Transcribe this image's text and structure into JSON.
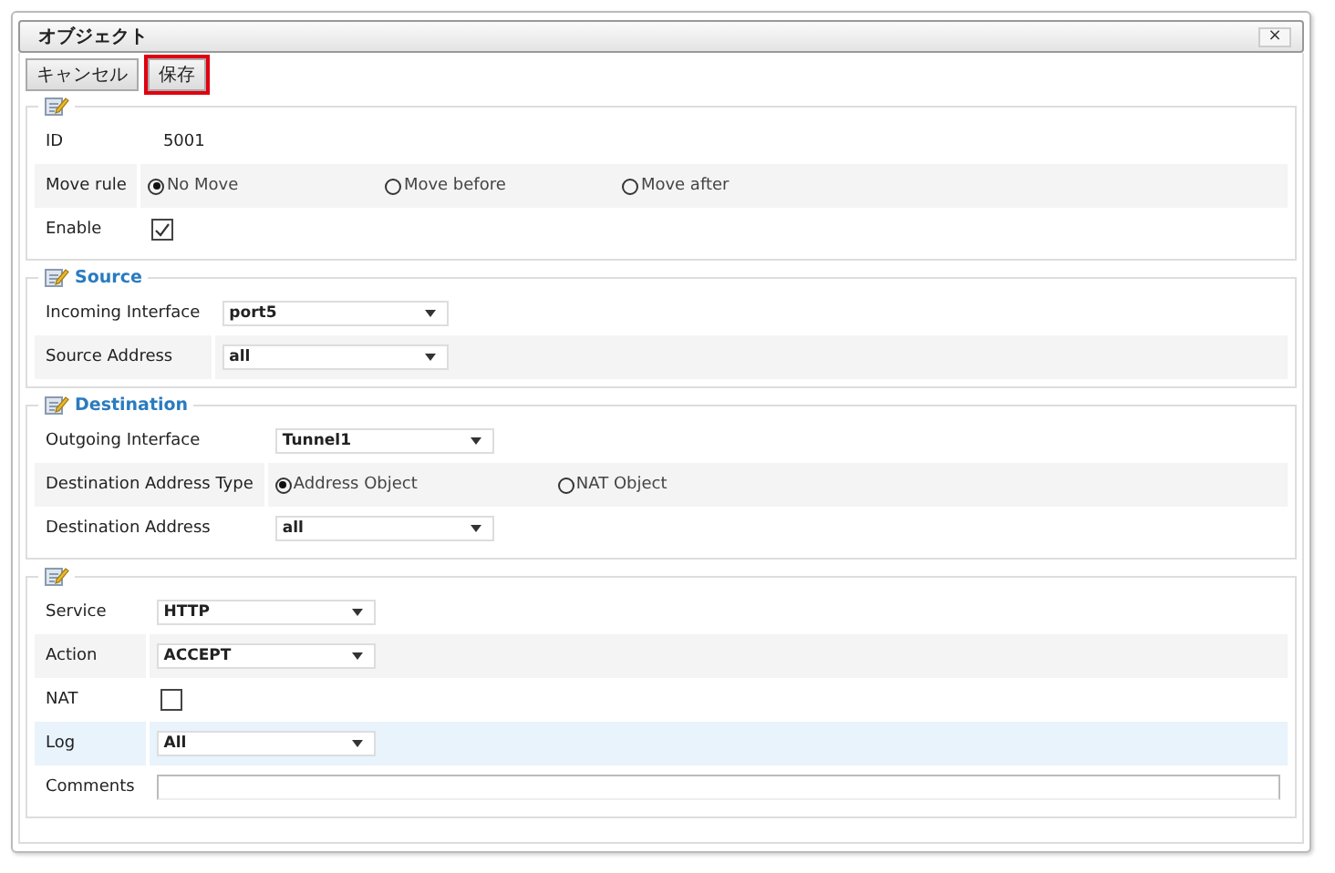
{
  "window": {
    "title": "オブジェクト",
    "close": "×"
  },
  "toolbar": [
    {
      "label": "キャンセル",
      "focused": false
    },
    {
      "label": "保存",
      "focused": true
    }
  ],
  "sections": [
    {
      "rows": [
        {
          "kind": "text",
          "label": "ID",
          "value": "5001",
          "highlighted": false
        },
        {
          "kind": "radio",
          "label": "Move rule",
          "options": [
            {
              "label": "No Move",
              "selected": true
            },
            {
              "label": "Move before",
              "selected": false
            },
            {
              "label": "Move after",
              "selected": false
            }
          ],
          "highlighted": false
        },
        {
          "kind": "checkbox",
          "label": "Enable",
          "checked": true,
          "highlighted": false
        }
      ]
    },
    {
      "title": "Source",
      "rows": [
        {
          "kind": "select",
          "label": "Incoming Interface",
          "value": "port5",
          "highlighted": false
        },
        {
          "kind": "select",
          "label": "Source Address",
          "value": "all",
          "highlighted": false
        }
      ]
    },
    {
      "title": "Destination",
      "rows": [
        {
          "kind": "select",
          "label": "Outgoing Interface",
          "value": "Tunnel1",
          "highlighted": false
        },
        {
          "kind": "radio",
          "label": "Destination Address Type",
          "options": [
            {
              "label": "Address Object",
              "selected": true
            },
            {
              "label": "NAT Object",
              "selected": false
            }
          ],
          "highlighted": false
        },
        {
          "kind": "select",
          "label": "Destination Address",
          "value": "all",
          "highlighted": false
        }
      ]
    },
    {
      "rows": [
        {
          "kind": "select",
          "label": "Service",
          "value": "HTTP",
          "highlighted": false
        },
        {
          "kind": "select",
          "label": "Action",
          "value": "ACCEPT",
          "highlighted": false
        },
        {
          "kind": "checkbox",
          "label": "NAT",
          "checked": false,
          "highlighted": false
        },
        {
          "kind": "select",
          "label": "Log",
          "value": "All",
          "highlighted": true
        },
        {
          "kind": "input",
          "label": "Comments",
          "value": "",
          "highlighted": false
        }
      ]
    }
  ]
}
